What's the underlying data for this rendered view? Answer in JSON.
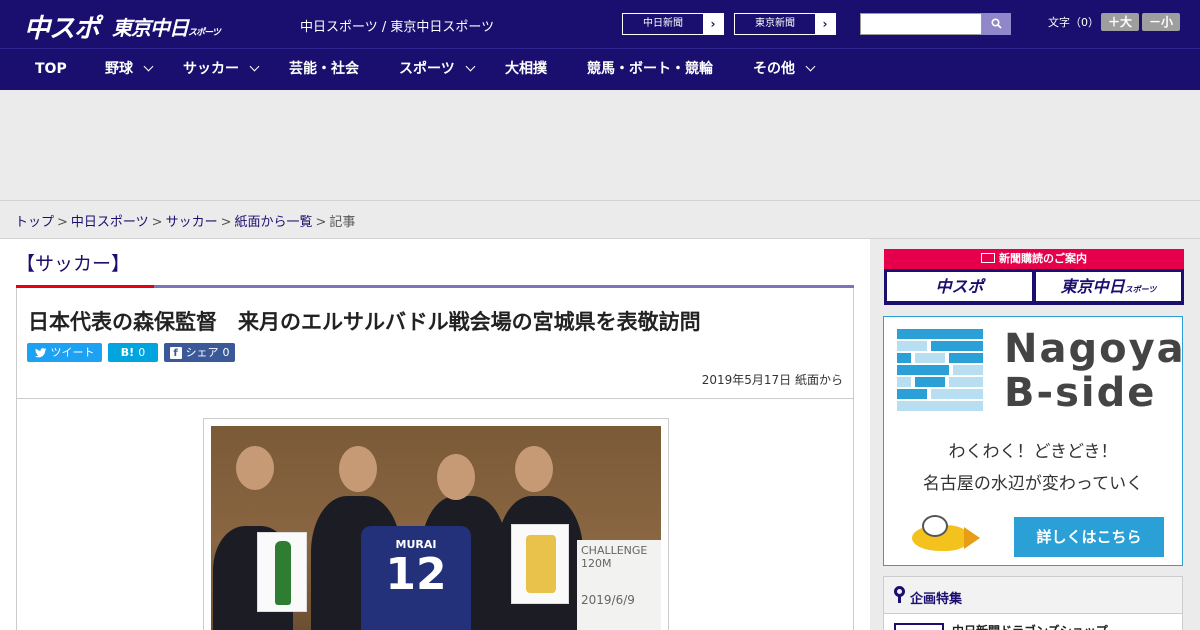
{
  "header": {
    "logo_chuspo": "中スポ",
    "logo_tokyo": "東京中日",
    "logo_tokyo_sub": "スポーツ",
    "site_title": "中日スポーツ / 東京中日スポーツ",
    "paper_links": [
      "中日新聞",
      "東京新聞"
    ],
    "search_placeholder": "",
    "font_size_label": "文字（0）",
    "font_larger": "＋大",
    "font_smaller": "－小"
  },
  "nav": {
    "items": [
      {
        "label": "TOP",
        "dropdown": false
      },
      {
        "label": "野球",
        "dropdown": true
      },
      {
        "label": "サッカー",
        "dropdown": true
      },
      {
        "label": "芸能・社会",
        "dropdown": false
      },
      {
        "label": "スポーツ",
        "dropdown": true
      },
      {
        "label": "大相撲",
        "dropdown": false
      },
      {
        "label": "競馬・ボート・競輪",
        "dropdown": false
      },
      {
        "label": "その他",
        "dropdown": true
      }
    ]
  },
  "breadcrumb": {
    "items": [
      "トップ",
      "中日スポーツ",
      "サッカー",
      "紙面から一覧"
    ],
    "current": "記事",
    "separator": ">"
  },
  "article": {
    "category": "【サッカー】",
    "headline": "日本代表の森保監督　来月のエルサルバドル戦会場の宮城県を表敬訪問",
    "share": {
      "tweet_label": "ツイート",
      "hatena_label": "B!",
      "hatena_count": "0",
      "facebook_label": "シェア",
      "facebook_count": "0"
    },
    "date": "2019年5月17日",
    "source": "紙面から",
    "photo": {
      "jersey_name": "MURAI",
      "jersey_number": "12",
      "card_text": "CHALLENGE\n120M",
      "card_date": "2019/6/9"
    }
  },
  "sidebar": {
    "subscribe_title": "新聞購読のご案内",
    "subscribe_chuspo": "中スポ",
    "subscribe_tokyo": "東京中日",
    "subscribe_tokyo_sub": "スポーツ",
    "bside_title_1": "Nagoya",
    "bside_title_2": "B-side",
    "bside_line_1": "わくわく！どきどき！",
    "bside_line_2": "名古屋の水辺が変わっていく",
    "bside_button": "詳しくはこちら",
    "features_title": "企画特集",
    "feature_item": "中日新聞ドラゴンズショップ"
  },
  "colors": {
    "brand_navy": "#1a0f6e",
    "accent_red": "#e60012",
    "accent_purple": "#7c74b9",
    "twitter": "#1da1f2",
    "hatena": "#00a4de",
    "facebook": "#3b5998",
    "bside_blue": "#2aa0d7"
  }
}
